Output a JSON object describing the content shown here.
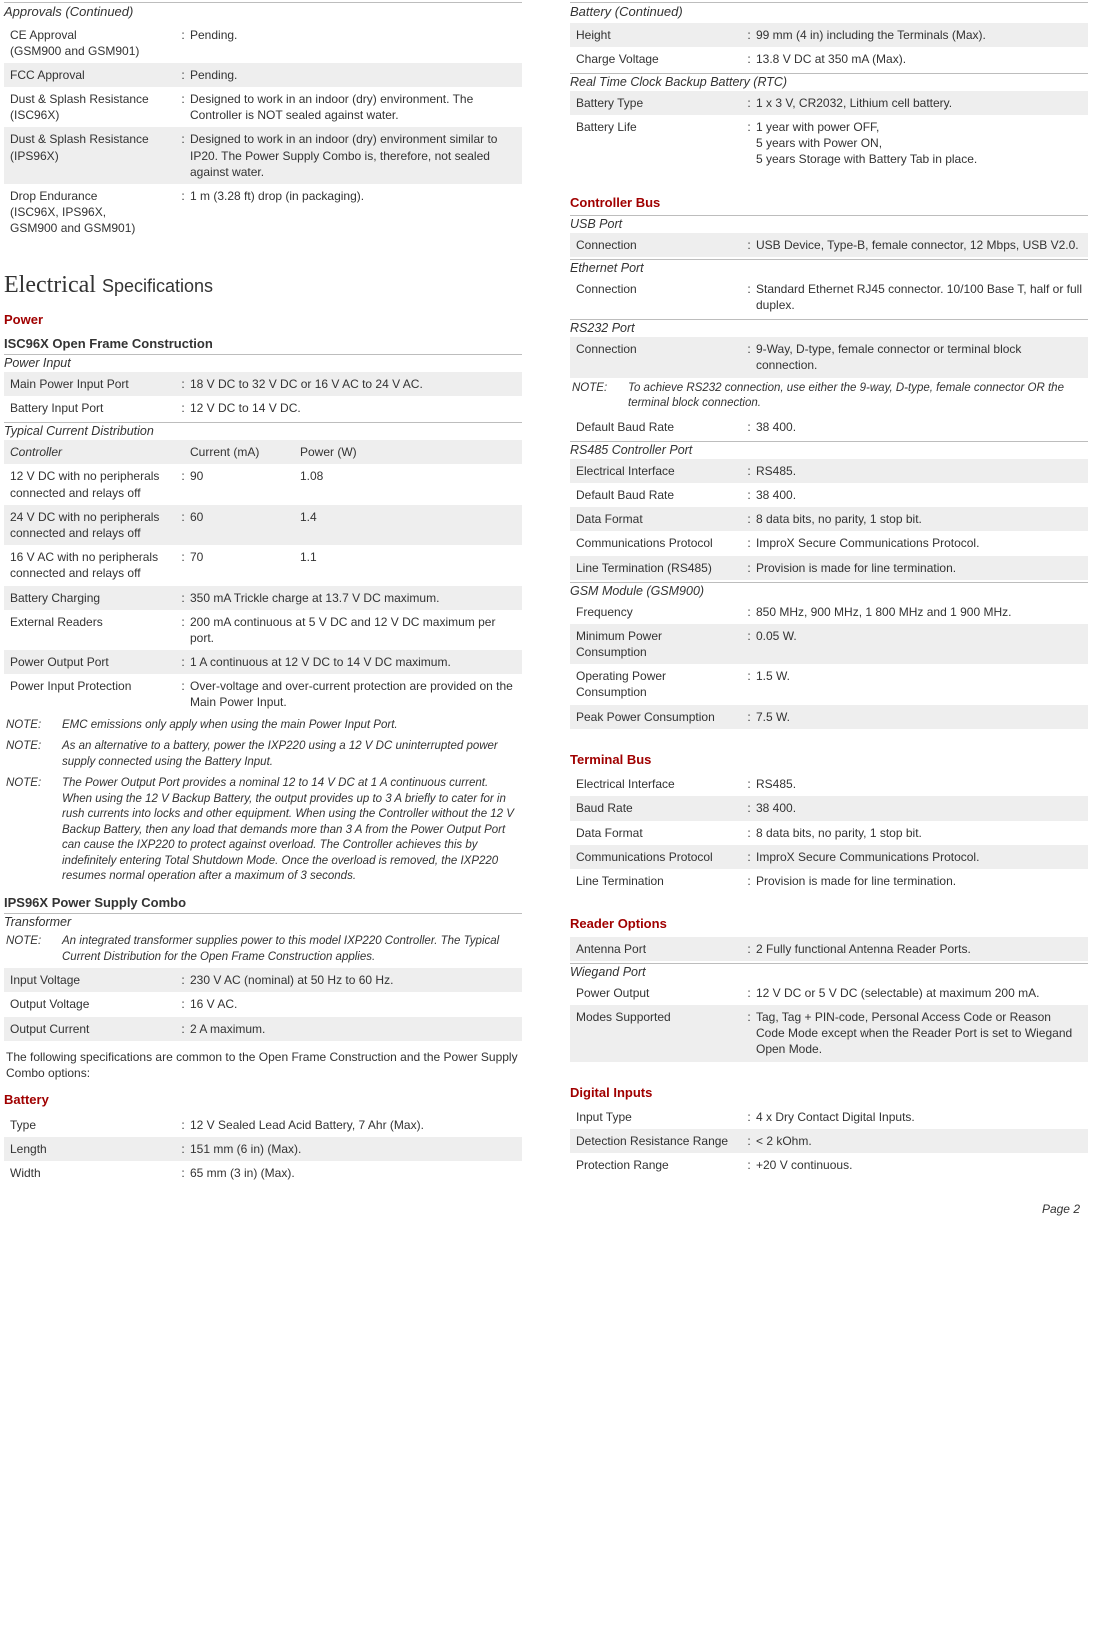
{
  "left": {
    "approvals_title": "Approvals (Continued)",
    "approvals_rows": [
      {
        "l": "CE Approval\n(GSM900 and GSM901)",
        "v": "Pending.",
        "s": false
      },
      {
        "l": "FCC Approval",
        "v": "Pending.",
        "s": true
      },
      {
        "l": "Dust & Splash Resistance (ISC96X)",
        "v": "Designed to work in an indoor (dry) environment.  The Controller is NOT sealed against water.",
        "s": false
      },
      {
        "l": "Dust & Splash Resistance (IPS96X)",
        "v": "Designed to work in an indoor (dry) environment similar to IP20.  The Power Supply Combo is, therefore, not sealed against water.",
        "s": true
      },
      {
        "l": "Drop Endurance\n(ISC96X, IPS96X,\nGSM900 and GSM901)",
        "v": "1 m (3.28 ft) drop (in packaging).",
        "s": false
      }
    ],
    "elec_heading_a": "Electrical",
    "elec_heading_b": "Specifications",
    "power_heading": "Power",
    "isc_heading": "ISC96X Open Frame Construction",
    "power_input_sub": "Power Input",
    "power_input_rows": [
      {
        "l": "Main Power Input Port",
        "v": "18 V DC to 32 V DC or 16 V AC to 24 V AC.",
        "s": true
      },
      {
        "l": "Battery Input Port",
        "v": "12 V DC to 14 V DC.",
        "s": false
      }
    ],
    "tcd_sub": "Typical Current Distribution",
    "tcd_header": {
      "l": "Controller",
      "c": "Current (mA)",
      "p": "Power (W)"
    },
    "tcd_rows": [
      {
        "l": "12 V DC with no peripherals connected and relays off",
        "c": "90",
        "p": "1.08",
        "s": false
      },
      {
        "l": "24 V DC with no peripherals connected and relays off",
        "c": "60",
        "p": "1.4",
        "s": true
      },
      {
        "l": "16 V AC with no peripherals connected and relays off",
        "c": "70",
        "p": "1.1",
        "s": false
      },
      {
        "l": "Battery Charging",
        "c": "",
        "p": "350 mA Trickle charge at 13.7 V DC maximum.",
        "s": true,
        "merge": true
      },
      {
        "l": "External Readers",
        "c": "",
        "p": "200 mA continuous at 5 V DC and 12 V DC maximum per port.",
        "s": false,
        "merge": true
      },
      {
        "l": "Power Output Port",
        "c": "",
        "p": "1 A continuous at 12 V DC to 14 V DC maximum.",
        "s": true,
        "merge": true
      },
      {
        "l": "Power Input Protection",
        "c": "",
        "p": "Over-voltage and over-current protection are provided on the Main Power Input.",
        "s": false,
        "merge": true
      }
    ],
    "notes": [
      "EMC emissions only apply when using the main Power Input Port.",
      "As an alternative to a battery, power the IXP220 using a 12 V DC uninterrupted power supply connected using the Battery Input.",
      "The Power Output Port provides a nominal 12 to 14 V DC at 1 A continuous current.  When using the 12 V Backup Battery, the output provides up to 3 A briefly to cater for in rush currents into locks and other equipment.  When using the Controller without the 12 V Backup Battery, then any load that demands more than 3 A from the Power Output Port can cause the IXP220 to protect against overload.  The Controller achieves this by indefinitely entering Total Shutdown Mode.  Once the overload is removed, the IXP220 resumes normal operation after a maximum of 3 seconds."
    ],
    "note_label": "NOTE:",
    "ips_heading": "IPS96X Power Supply Combo",
    "transformer_sub": "Transformer",
    "transformer_note": "An integrated transformer supplies power to this model IXP220 Controller.  The Typical Current Distribution for the Open Frame Construction applies.",
    "transformer_rows": [
      {
        "l": "Input Voltage",
        "v": "230 V AC (nominal) at 50 Hz to 60 Hz.",
        "s": true
      },
      {
        "l": "Output Voltage",
        "v": "16 V AC.",
        "s": false
      },
      {
        "l": "Output Current",
        "v": "2 A maximum.",
        "s": true
      }
    ],
    "common_para": "The following specifications are common to the Open Frame Construction and the Power Supply Combo options:",
    "battery_heading": "Battery",
    "battery_rows": [
      {
        "l": "Type",
        "v": "12 V Sealed Lead Acid Battery, 7 Ahr (Max).",
        "s": false
      },
      {
        "l": "Length",
        "v": "151 mm (6 in) (Max).",
        "s": true
      },
      {
        "l": "Width",
        "v": "65 mm (3 in) (Max).",
        "s": false
      }
    ]
  },
  "right": {
    "battery_cont": "Battery (Continued)",
    "battery_rows": [
      {
        "l": "Height",
        "v": "99 mm (4 in) including the Terminals (Max).",
        "s": true
      },
      {
        "l": "Charge Voltage",
        "v": "13.8 V DC at 350 mA (Max).",
        "s": false
      }
    ],
    "rtc_sub": "Real Time Clock Backup Battery (RTC)",
    "rtc_rows": [
      {
        "l": "Battery Type",
        "v": "1 x 3 V, CR2032, Lithium cell battery.",
        "s": true
      },
      {
        "l": "Battery Life",
        "v": "1 year with power OFF,\n5 years with Power ON,\n5 years Storage with Battery Tab in place.",
        "s": false
      }
    ],
    "cbus_heading": "Controller Bus",
    "usb_sub": "USB Port",
    "usb_rows": [
      {
        "l": "Connection",
        "v": "USB Device, Type-B, female connector, 12 Mbps, USB V2.0.",
        "s": true
      }
    ],
    "eth_sub": "Ethernet Port",
    "eth_rows": [
      {
        "l": "Connection",
        "v": "Standard Ethernet RJ45 connector.  10/100 Base T, half or full duplex.",
        "s": false
      }
    ],
    "rs232_sub": "RS232 Port",
    "rs232_rows": [
      {
        "l": "Connection",
        "v": "9-Way, D-type, female connector or terminal block connection.",
        "s": true
      }
    ],
    "rs232_note": "To achieve RS232 connection, use either the 9-way, D-type, female connector OR the terminal block connection.",
    "rs232_rows2": [
      {
        "l": "Default Baud Rate",
        "v": "38 400.",
        "s": false
      }
    ],
    "rs485_sub": "RS485 Controller Port",
    "rs485_rows": [
      {
        "l": "Electrical Interface",
        "v": "RS485.",
        "s": true
      },
      {
        "l": "Default Baud Rate",
        "v": "38 400.",
        "s": false
      },
      {
        "l": "Data Format",
        "v": "8 data bits, no parity, 1 stop bit.",
        "s": true
      },
      {
        "l": "Communications Protocol",
        "v": "ImproX Secure Communications Protocol.",
        "s": false
      },
      {
        "l": "Line Termination (RS485)",
        "v": "Provision is made for line termination.",
        "s": true
      }
    ],
    "gsm_sub": "GSM Module (GSM900)",
    "gsm_rows": [
      {
        "l": "Frequency",
        "v": "850 MHz, 900 MHz, 1 800 MHz and 1 900 MHz.",
        "s": false
      },
      {
        "l": "Minimum Power Consumption",
        "v": "0.05 W.",
        "s": true
      },
      {
        "l": "Operating Power Consumption",
        "v": "1.5 W.",
        "s": false
      },
      {
        "l": "Peak Power Consumption",
        "v": "7.5 W.",
        "s": true
      }
    ],
    "tbus_heading": "Terminal Bus",
    "tbus_rows": [
      {
        "l": "Electrical Interface",
        "v": "RS485.",
        "s": false
      },
      {
        "l": "Baud Rate",
        "v": "38 400.",
        "s": true
      },
      {
        "l": "Data Format",
        "v": "8 data bits, no parity, 1 stop bit.",
        "s": false
      },
      {
        "l": "Communications Protocol",
        "v": "ImproX Secure Communications Protocol.",
        "s": true
      },
      {
        "l": "Line Termination",
        "v": "Provision is made for line termination.",
        "s": false
      }
    ],
    "reader_heading": "Reader Options",
    "reader_rows": [
      {
        "l": "Antenna Port",
        "v": "2 Fully functional Antenna Reader Ports.",
        "s": true
      }
    ],
    "wiegand_sub": "Wiegand Port",
    "wiegand_rows": [
      {
        "l": "Power Output",
        "v": "12 V DC or 5 V DC (selectable) at maximum 200 mA.",
        "s": false
      },
      {
        "l": "Modes Supported",
        "v": "Tag, Tag + PIN-code, Personal Access Code or Reason Code Mode except when the Reader Port is set to Wiegand Open Mode.",
        "s": true
      }
    ],
    "digital_heading": "Digital Inputs",
    "digital_rows": [
      {
        "l": "Input Type",
        "v": "4 x Dry Contact Digital Inputs.",
        "s": false
      },
      {
        "l": "Detection Resistance Range",
        "v": "< 2 kOhm.",
        "s": true
      },
      {
        "l": "Protection Range",
        "v": "+20 V continuous.",
        "s": false
      }
    ]
  },
  "colon": ":",
  "page_number": "Page 2"
}
